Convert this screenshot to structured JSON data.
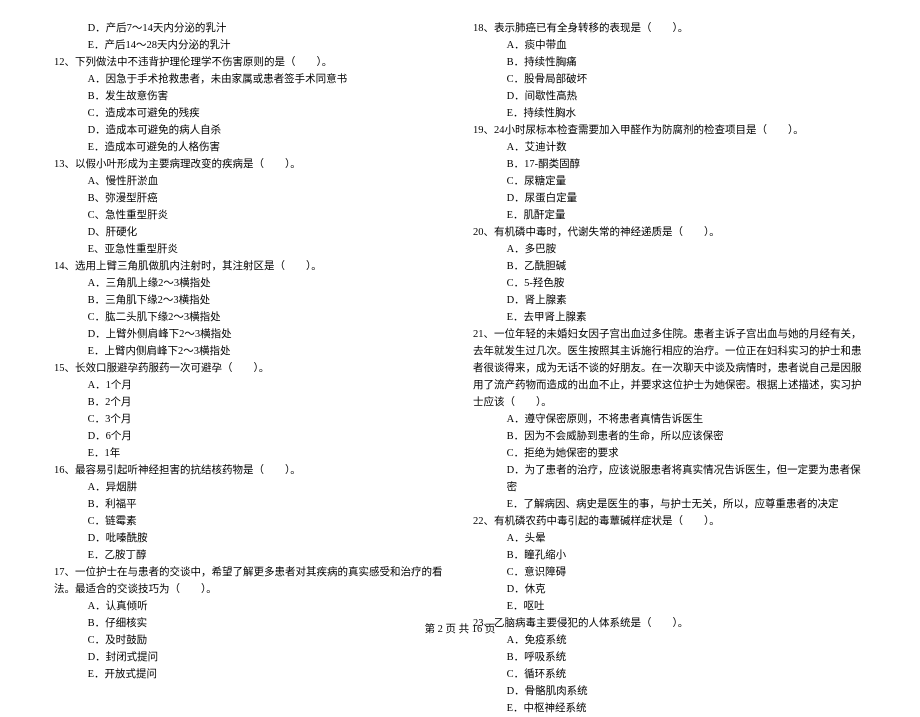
{
  "left": {
    "pre_opts": [
      "D．产后7～14天内分泌的乳汁",
      "E．产后14～28天内分泌的乳汁"
    ],
    "q12": {
      "stem": "12、下列做法中不违背护理伦理学不伤害原则的是（　　）。",
      "opts": [
        "A．因急于手术抢救患者，未由家属或患者签手术同意书",
        "B．发生故意伤害",
        "C．造成本可避免的残疾",
        "D．造成本可避免的病人自杀",
        "E．造成本可避免的人格伤害"
      ]
    },
    "q13": {
      "stem": "13、以假小叶形成为主要病理改变的疾病是（　　）。",
      "opts": [
        "A、慢性肝淤血",
        "B、弥漫型肝癌",
        "C、急性重型肝炎",
        "D、肝硬化",
        "E、亚急性重型肝炎"
      ]
    },
    "q14": {
      "stem": "14、选用上臂三角肌做肌内注射时，其注射区是（　　）。",
      "opts": [
        "A．三角肌上缘2～3横指处",
        "B．三角肌下缘2～3横指处",
        "C．肱二头肌下缘2～3横指处",
        "D．上臂外侧肩峰下2～3横指处",
        "E．上臂内侧肩峰下2～3横指处"
      ]
    },
    "q15": {
      "stem": "15、长效口服避孕药服药一次可避孕（　　）。",
      "opts": [
        "A．1个月",
        "B．2个月",
        "C．3个月",
        "D．6个月",
        "E．1年"
      ]
    },
    "q16": {
      "stem": "16、最容易引起听神经担害的抗结核药物是（　　）。",
      "opts": [
        "A．异烟肼",
        "B．利福平",
        "C．链霉素",
        "D．吡嗪酰胺",
        "E．乙胺丁醇"
      ]
    },
    "q17": {
      "stem": "17、一位护士在与患者的交谈中，希望了解更多患者对其疾病的真实感受和治疗的看法。最适合的交谈技巧为（　　）。",
      "opts": [
        "A．认真倾听",
        "B．仔细核实",
        "C．及时鼓励",
        "D．封闭式提问",
        "E．开放式提问"
      ]
    }
  },
  "right": {
    "q18": {
      "stem": "18、表示肺癌已有全身转移的表现是（　　）。",
      "opts": [
        "A．痰中带血",
        "B．持续性胸痛",
        "C．股骨局部破坏",
        "D．间歇性高热",
        "E．持续性胸水"
      ]
    },
    "q19": {
      "stem": "19、24小时尿标本检查需要加入甲醛作为防腐剂的检查项目是（　　）。",
      "opts": [
        "A．艾迪计数",
        "B．17-酮类固醇",
        "C．尿糖定量",
        "D．尿蛋白定量",
        "E．肌酐定量"
      ]
    },
    "q20": {
      "stem": "20、有机磷中毒时，代谢失常的神经递质是（　　）。",
      "opts": [
        "A．多巴胺",
        "B．乙酰胆碱",
        "C．5-羟色胺",
        "D．肾上腺素",
        "E．去甲肾上腺素"
      ]
    },
    "q21": {
      "stem": "21、一位年轻的未婚妇女因子宫出血过多住院。患者主诉子宫出血与她的月经有关，去年就发生过几次。医生按照其主诉施行相应的治疗。一位正在妇科实习的护士和患者很谈得来，成为无话不谈的好朋友。在一次聊天中谈及病情时，患者说自己是因服用了流产药物而造成的出血不止，并要求这位护士为她保密。根据上述描述，实习护士应该（　　）。",
      "opts": [
        "A．遵守保密原则，不将患者真情告诉医生",
        "B．因为不会威胁到患者的生命，所以应该保密",
        "C．拒绝为她保密的要求",
        "D．为了患者的治疗，应该说服患者将真实情况告诉医生，但一定要为患者保密",
        "E．了解病因、病史是医生的事，与护士无关，所以，应尊重患者的决定"
      ]
    },
    "q22": {
      "stem": "22、有机磷农药中毒引起的毒蕈碱样症状是（　　）。",
      "opts": [
        "A．头晕",
        "B．瞳孔缩小",
        "C．意识障碍",
        "D．休克",
        "E．呕吐"
      ]
    },
    "q23": {
      "stem": "23、乙脑病毒主要侵犯的人体系统是（　　）。",
      "opts": [
        "A．免疫系统",
        "B．呼吸系统",
        "C．循环系统",
        "D．骨骼肌肉系统",
        "E．中枢神经系统"
      ]
    }
  },
  "footer": "第 2 页 共 16 页"
}
